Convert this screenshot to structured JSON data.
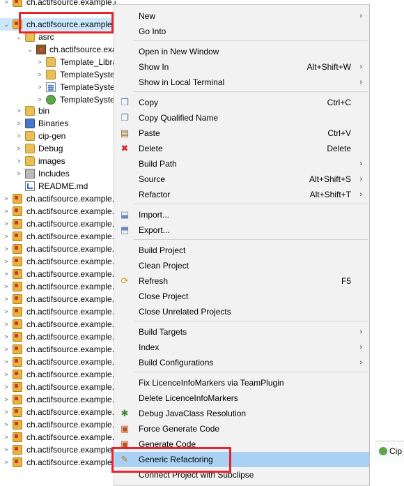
{
  "tree": {
    "top_partial": {
      "label": "ch.actifsource.example.cip.ifpmpsystem [ch.actifsource.example.cip master]"
    },
    "selected_project": {
      "label": "ch.actifsource.example.cip.ifpmpsystem"
    },
    "asrc": {
      "label": "asrc"
    },
    "package": {
      "label": "ch.actifsource.example.cip"
    },
    "children": [
      {
        "label": "Template_Library",
        "icon": "folder-icon"
      },
      {
        "label": "TemplateSystem",
        "icon": "folder-icon"
      },
      {
        "label": "TemplateSystem",
        "icon": "file-icon"
      },
      {
        "label": "TemplateSystem",
        "icon": "gear-icon"
      }
    ],
    "folders": [
      {
        "label": "bin",
        "icon": "folder-icon",
        "expandable": true
      },
      {
        "label": "Binaries",
        "icon": "binaries-icon",
        "expandable": true
      },
      {
        "label": "cip-gen",
        "icon": "folder-icon",
        "expandable": true
      },
      {
        "label": "Debug",
        "icon": "folder-icon",
        "expandable": true
      },
      {
        "label": "images",
        "icon": "folder-icon",
        "expandable": true
      },
      {
        "label": "Includes",
        "icon": "includes-icon",
        "expandable": true
      },
      {
        "label": "README.md",
        "icon": "readme-icon",
        "expandable": false
      }
    ],
    "projects": [
      "ch.actifsource.example.cip.a",
      "ch.actifsource.example.cip.b",
      "ch.actifsource.example.cip.c",
      "ch.actifsource.example.cip.d",
      "ch.actifsource.example.cip.e",
      "ch.actifsource.example.cip.f",
      "ch.actifsource.example.cip.g",
      "ch.actifsource.example.cip.h",
      "ch.actifsource.example.cip.i",
      "ch.actifsource.example.cip.j",
      "ch.actifsource.example.cip.k",
      "ch.actifsource.example.cip.l",
      "ch.actifsource.example.cip.m",
      "ch.actifsource.example.cip.n",
      "ch.actifsource.example.cip.o",
      "ch.actifsource.example.cip.p",
      "ch.actifsource.example.cip.q",
      "ch.actifsource.example.cip.r",
      "ch.actifsource.example.cip.s",
      "ch.actifsource.example.cip.t",
      "ch.actifsource.example.cip.u",
      "ch.actifsource.example.cip.v"
    ]
  },
  "menu": {
    "items": [
      {
        "label": "New",
        "accel": "",
        "submenu": true,
        "icon": ""
      },
      {
        "label": "Go Into",
        "accel": "",
        "submenu": false,
        "icon": ""
      },
      {
        "label": "Open in New Window",
        "accel": "",
        "submenu": false,
        "icon": ""
      },
      {
        "label": "Show In",
        "accel": "Alt+Shift+W",
        "submenu": true,
        "icon": ""
      },
      {
        "label": "Show in Local Terminal",
        "accel": "",
        "submenu": true,
        "icon": ""
      },
      {
        "label": "Copy",
        "accel": "Ctrl+C",
        "submenu": false,
        "icon": "copy-icon"
      },
      {
        "label": "Copy Qualified Name",
        "accel": "",
        "submenu": false,
        "icon": "copy-qualified-name-icon"
      },
      {
        "label": "Paste",
        "accel": "Ctrl+V",
        "submenu": false,
        "icon": "paste-icon"
      },
      {
        "label": "Delete",
        "accel": "Delete",
        "submenu": false,
        "icon": "delete-icon"
      },
      {
        "label": "Build Path",
        "accel": "",
        "submenu": true,
        "icon": ""
      },
      {
        "label": "Source",
        "accel": "Alt+Shift+S",
        "submenu": true,
        "icon": ""
      },
      {
        "label": "Refactor",
        "accel": "Alt+Shift+T",
        "submenu": true,
        "icon": ""
      },
      {
        "label": "Import...",
        "accel": "",
        "submenu": false,
        "icon": "import-icon"
      },
      {
        "label": "Export...",
        "accel": "",
        "submenu": false,
        "icon": "export-icon"
      },
      {
        "label": "Build Project",
        "accel": "",
        "submenu": false,
        "icon": ""
      },
      {
        "label": "Clean Project",
        "accel": "",
        "submenu": false,
        "icon": ""
      },
      {
        "label": "Refresh",
        "accel": "F5",
        "submenu": false,
        "icon": "refresh-icon"
      },
      {
        "label": "Close Project",
        "accel": "",
        "submenu": false,
        "icon": ""
      },
      {
        "label": "Close Unrelated Projects",
        "accel": "",
        "submenu": false,
        "icon": ""
      },
      {
        "label": "Build Targets",
        "accel": "",
        "submenu": true,
        "icon": ""
      },
      {
        "label": "Index",
        "accel": "",
        "submenu": true,
        "icon": ""
      },
      {
        "label": "Build Configurations",
        "accel": "",
        "submenu": true,
        "icon": ""
      },
      {
        "label": "Fix LicenceInfoMarkers via TeamPlugin",
        "accel": "",
        "submenu": false,
        "icon": ""
      },
      {
        "label": "Delete LicenceInfoMarkers",
        "accel": "",
        "submenu": false,
        "icon": ""
      },
      {
        "label": "Debug JavaClass Resolution",
        "accel": "",
        "submenu": false,
        "icon": "debug-icon"
      },
      {
        "label": "Force Generate Code",
        "accel": "",
        "submenu": false,
        "icon": "generate-icon"
      },
      {
        "label": "Generate Code",
        "accel": "",
        "submenu": false,
        "icon": "generate-icon"
      },
      {
        "label": "Generic Refactoring",
        "accel": "",
        "submenu": false,
        "icon": "refactoring-icon",
        "highlighted": true
      },
      {
        "label": "Connect Project with Subclipse",
        "accel": "",
        "submenu": false,
        "icon": ""
      }
    ]
  },
  "right_tab": {
    "label": "Cip"
  }
}
